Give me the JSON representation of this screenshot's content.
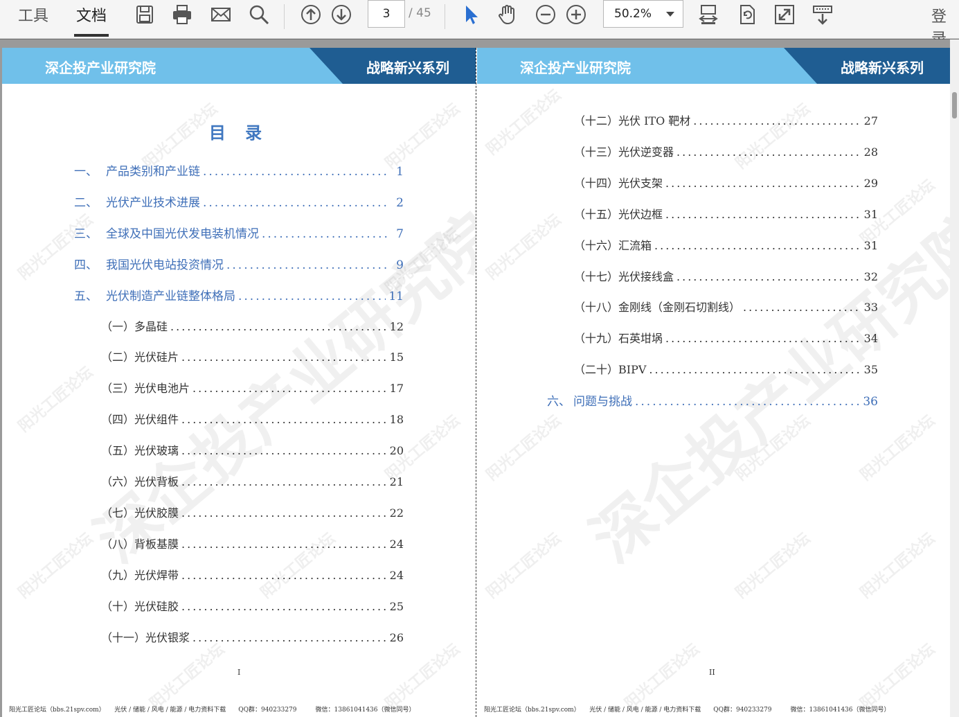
{
  "toolbar": {
    "tabs": [
      {
        "label": "工具"
      },
      {
        "label": "文档"
      }
    ],
    "page_input": "3",
    "page_total": "/ 45",
    "zoom": "50.2%",
    "login": "登录",
    "icons": [
      "save-icon",
      "print-icon",
      "mail-icon",
      "search-icon",
      "page-up-icon",
      "page-down-icon",
      "select-cursor-icon",
      "hand-tool-icon",
      "zoom-out-icon",
      "zoom-in-icon",
      "fit-page-icon",
      "rotate-page-icon",
      "fullscreen-icon",
      "read-mode-icon"
    ]
  },
  "colors": {
    "header_light": "#70c0ea",
    "header_dark": "#1f5d92",
    "toc_blue": "#3f6fb8"
  },
  "left_page": {
    "header_left": "深企投产业研究院",
    "header_right": "战略新兴系列",
    "toc_title": "目 录",
    "entries": [
      {
        "num": "一、",
        "label": "产品类别和产业链",
        "page": "1"
      },
      {
        "num": "二、",
        "label": "光伏产业技术进展",
        "page": "2"
      },
      {
        "num": "三、",
        "label": "全球及中国光伏发电装机情况",
        "page": "7"
      },
      {
        "num": "四、",
        "label": "我国光伏电站投资情况",
        "page": "9"
      },
      {
        "num": "五、",
        "label": "光伏制造产业链整体格局",
        "page": "11"
      },
      {
        "label": "（一）多晶硅",
        "page": "12"
      },
      {
        "label": "（二）光伏硅片",
        "page": "15"
      },
      {
        "label": "（三）光伏电池片",
        "page": "17"
      },
      {
        "label": "（四）光伏组件",
        "page": "18"
      },
      {
        "label": "（五）光伏玻璃",
        "page": "20"
      },
      {
        "label": "（六）光伏背板",
        "page": "21"
      },
      {
        "label": "（七）光伏胶膜",
        "page": "22"
      },
      {
        "label": "（八）背板基膜",
        "page": "24"
      },
      {
        "label": "（九）光伏焊带",
        "page": "24"
      },
      {
        "label": "（十）光伏硅胶",
        "page": "25"
      },
      {
        "label": "（十一）光伏银浆",
        "page": "26"
      }
    ],
    "page_number": "I",
    "footer": "阳光工匠论坛（bbs.21spv.com）　　光伏 / 储能 / 风电 / 能源 / 电力资料下载　　QQ群：940233279　　　微信：13861041436（微信同号）"
  },
  "right_page": {
    "header_left": "深企投产业研究院",
    "header_right": "战略新兴系列",
    "entries": [
      {
        "label": "（十二）光伏 ITO 靶材",
        "page": "27"
      },
      {
        "label": "（十三）光伏逆变器",
        "page": "28"
      },
      {
        "label": "（十四）光伏支架",
        "page": "29"
      },
      {
        "label": "（十五）光伏边框",
        "page": "31"
      },
      {
        "label": "（十六）汇流箱",
        "page": "31"
      },
      {
        "label": "（十七）光伏接线盒",
        "page": "32"
      },
      {
        "label": "（十八）金刚线（金刚石切割线）",
        "page": "33"
      },
      {
        "label": "（十九）石英坩埚",
        "page": "34"
      },
      {
        "label": "（二十）BIPV",
        "page": "35"
      },
      {
        "num": "六、",
        "label": "问题与挑战",
        "page": "36"
      }
    ],
    "page_number": "II",
    "footer": "阳光工匠论坛（bbs.21spv.com）　　光伏 / 储能 / 风电 / 能源 / 电力资料下载　　QQ群：940233279　　　微信：13861041436（微信同号）"
  },
  "watermarks": {
    "large": "深企投产业研究院",
    "small": "阳光工匠论坛"
  }
}
